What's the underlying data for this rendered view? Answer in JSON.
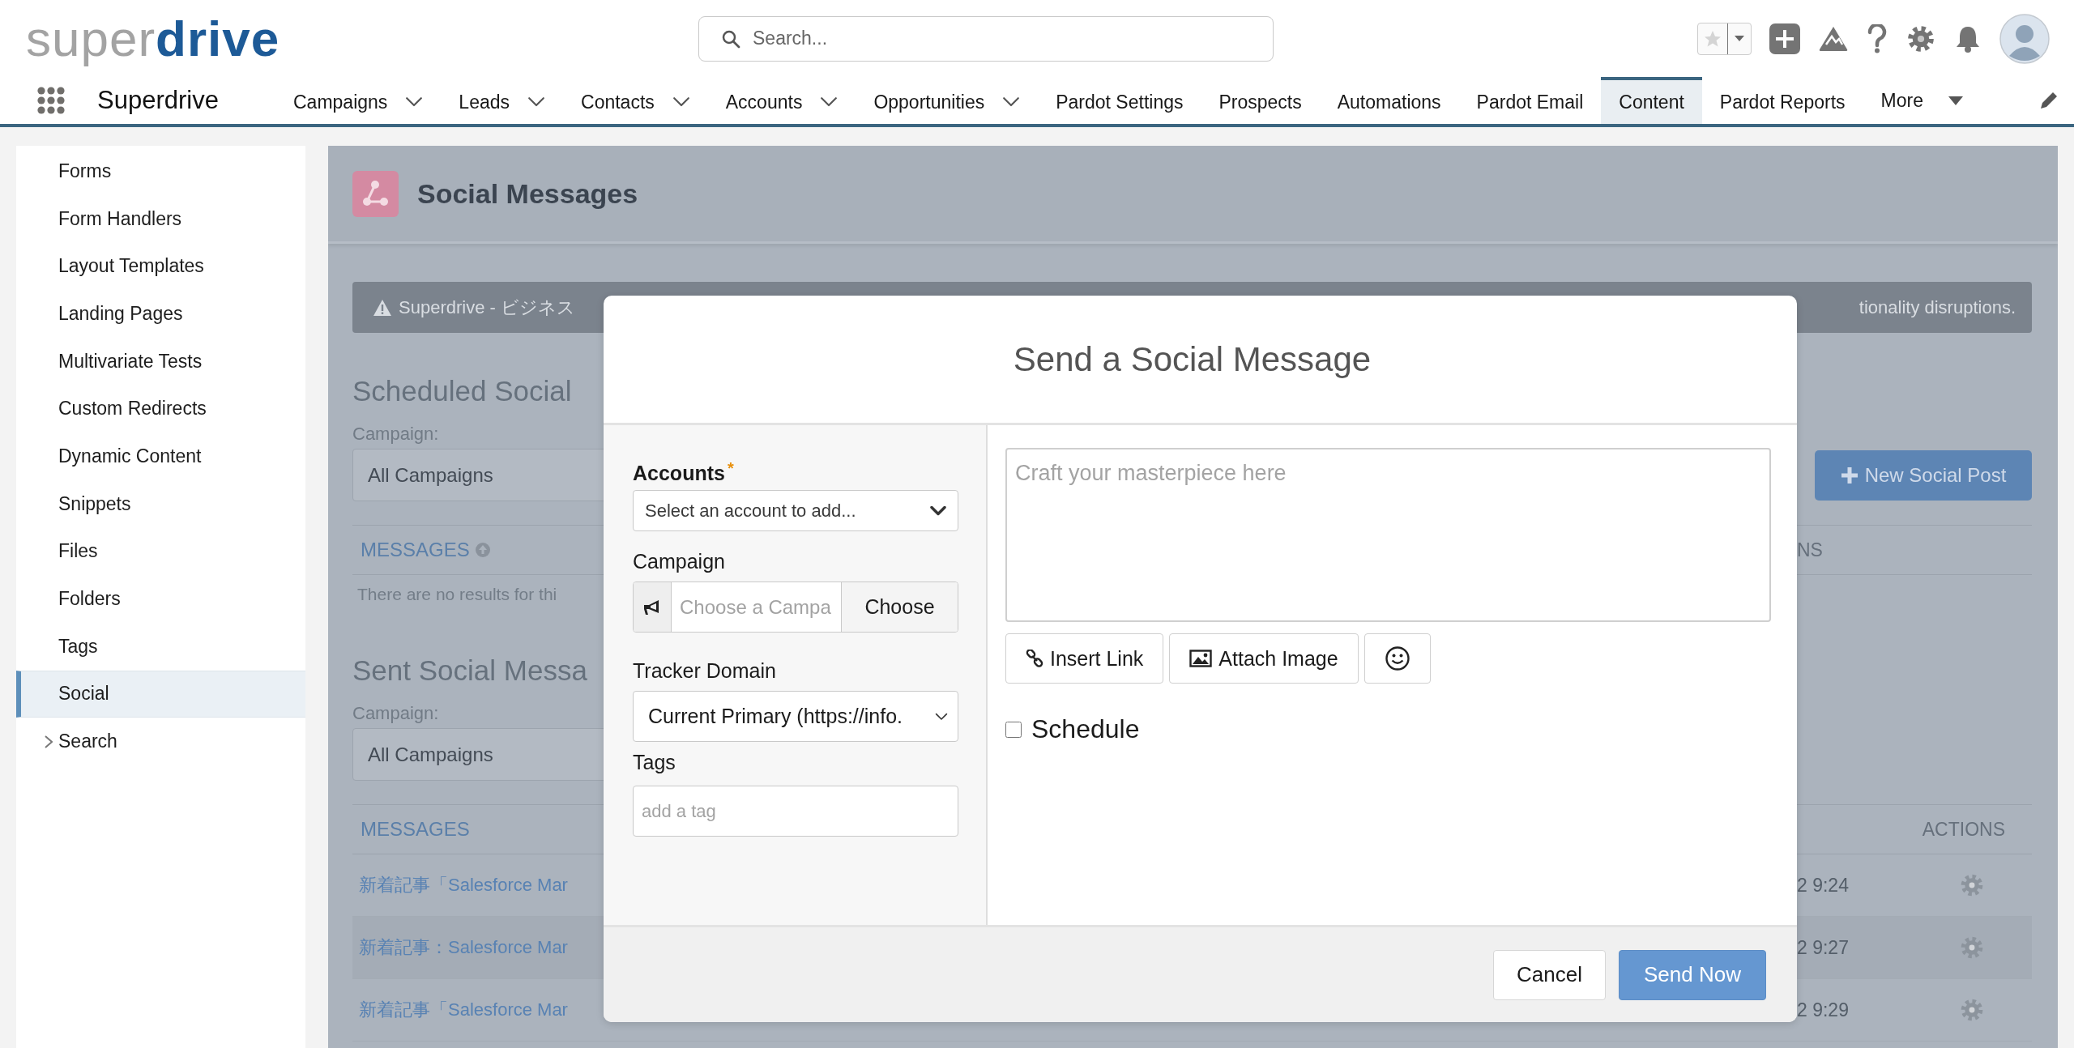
{
  "header": {
    "logo": "super**drive**",
    "search": {
      "placeholder": "Search..."
    }
  },
  "app_name": "Superdrive",
  "nav": [
    {
      "label": "Campaigns",
      "has_menu": true,
      "selected": false
    },
    {
      "label": "Leads",
      "has_menu": true,
      "selected": false
    },
    {
      "label": "Contacts",
      "has_menu": true,
      "selected": false
    },
    {
      "label": "Accounts",
      "has_menu": true,
      "selected": false
    },
    {
      "label": "Opportunities",
      "has_menu": true,
      "selected": false
    },
    {
      "label": "Pardot Settings",
      "has_menu": false,
      "selected": false
    },
    {
      "label": "Prospects",
      "has_menu": false,
      "selected": false
    },
    {
      "label": "Automations",
      "has_menu": false,
      "selected": false
    },
    {
      "label": "Pardot Email",
      "has_menu": false,
      "selected": false
    },
    {
      "label": "Content",
      "has_menu": false,
      "selected": true
    },
    {
      "label": "Pardot Reports",
      "has_menu": false,
      "selected": false
    }
  ],
  "nav_more": "More",
  "sidebar": {
    "items": [
      {
        "label": "Forms",
        "kind": "item",
        "selected": false
      },
      {
        "label": "Form Handlers",
        "kind": "item",
        "selected": false
      },
      {
        "label": "Layout Templates",
        "kind": "item",
        "selected": false
      },
      {
        "label": "Landing Pages",
        "kind": "item",
        "selected": false
      },
      {
        "label": "Multivariate Tests",
        "kind": "item",
        "selected": false
      },
      {
        "label": "Custom Redirects",
        "kind": "item",
        "selected": false
      },
      {
        "label": "Dynamic Content",
        "kind": "item",
        "selected": false
      },
      {
        "label": "Snippets",
        "kind": "item",
        "selected": false
      },
      {
        "label": "Files",
        "kind": "item",
        "selected": false
      },
      {
        "label": "Folders",
        "kind": "item",
        "selected": false
      },
      {
        "label": "Tags",
        "kind": "item",
        "selected": false
      },
      {
        "label": "Social",
        "kind": "item",
        "selected": true
      },
      {
        "label": "Search",
        "kind": "group",
        "selected": false,
        "expanded": false
      }
    ]
  },
  "page": {
    "title": "Social Messages",
    "banner": {
      "start": "Superdrive - ビジネス",
      "end": "tionality disruptions."
    },
    "new_post_button": "New Social Post",
    "scheduled": {
      "heading": "Scheduled Social",
      "campaign_label": "Campaign:",
      "campaign_value": "All Campaigns",
      "messages_header": "MESSAGES",
      "column_end": "NS",
      "empty_text": "There are no results for thi"
    },
    "sent": {
      "heading": "Sent Social Messa",
      "campaign_label": "Campaign:",
      "campaign_value": "All Campaigns",
      "messages_header": "MESSAGES",
      "actions_header": "ACTIONS",
      "rows": [
        {
          "message": "新着記事「Salesforce Mar",
          "time": "2 9:24"
        },
        {
          "message": "新着記事：Salesforce Mar",
          "time": "2 9:27"
        },
        {
          "message": "新着記事「Salesforce Mar",
          "time": "2 9:29"
        }
      ]
    }
  },
  "modal": {
    "title": "Send a Social Message",
    "accounts": {
      "label": "Accounts",
      "required_mark": "*",
      "placeholder": "Select an account to add..."
    },
    "campaign": {
      "label": "Campaign",
      "placeholder": "Choose a Campa",
      "button": "Choose"
    },
    "tracker_domain": {
      "label": "Tracker Domain",
      "value": "Current Primary (https://info."
    },
    "tags": {
      "label": "Tags",
      "placeholder": "add a tag"
    },
    "message": {
      "placeholder": "Craft your masterpiece here"
    },
    "tools": [
      {
        "kind": "link",
        "label": "Insert Link"
      },
      {
        "kind": "image",
        "label": "Attach Image"
      },
      {
        "kind": "emoji"
      }
    ],
    "schedule": {
      "label": "Schedule",
      "checked": false
    },
    "buttons": [
      {
        "kind": "secondary",
        "label": "Cancel"
      },
      {
        "kind": "primary",
        "label": "Send Now"
      }
    ]
  }
}
